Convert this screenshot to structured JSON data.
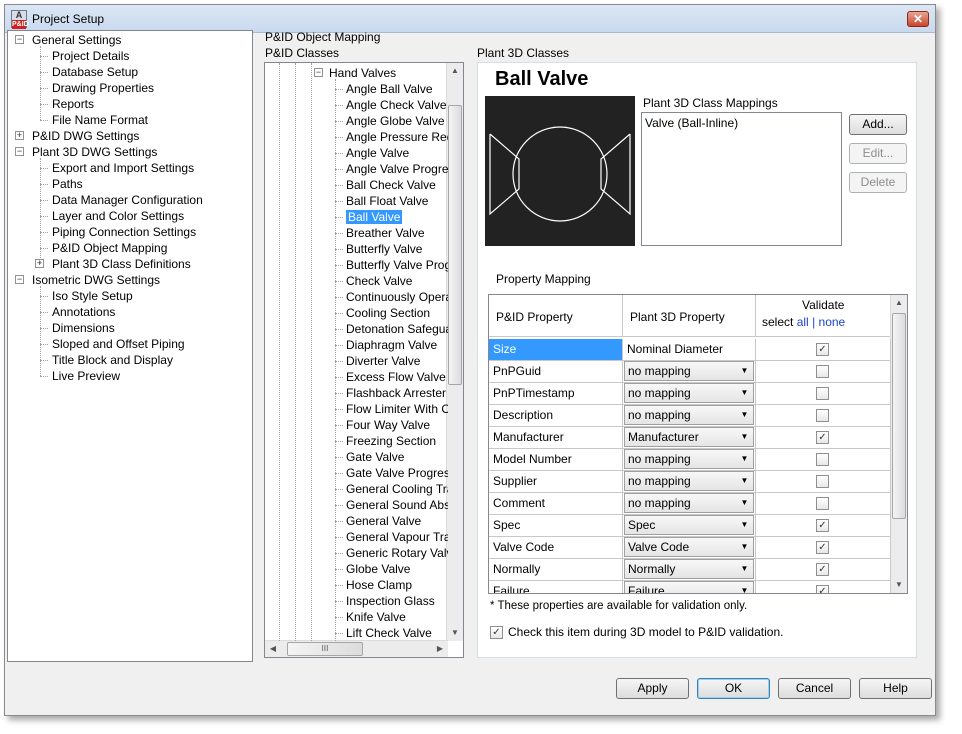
{
  "window": {
    "title": "Project Setup",
    "icon_text": "A",
    "icon_badge": "P&ID"
  },
  "left_tree": [
    {
      "label": "General Settings",
      "level": 0,
      "expander": "−"
    },
    {
      "label": "Project Details",
      "level": 1
    },
    {
      "label": "Database Setup",
      "level": 1
    },
    {
      "label": "Drawing Properties",
      "level": 1
    },
    {
      "label": "Reports",
      "level": 1
    },
    {
      "label": "File Name Format",
      "level": 1
    },
    {
      "label": "P&ID DWG Settings",
      "level": 0,
      "expander": "+"
    },
    {
      "label": "Plant 3D DWG Settings",
      "level": 0,
      "expander": "−"
    },
    {
      "label": "Export and Import Settings",
      "level": 1
    },
    {
      "label": "Paths",
      "level": 1
    },
    {
      "label": "Data Manager Configuration",
      "level": 1
    },
    {
      "label": "Layer and Color Settings",
      "level": 1
    },
    {
      "label": "Piping Connection Settings",
      "level": 1
    },
    {
      "label": "P&ID Object Mapping",
      "level": 1
    },
    {
      "label": "Plant 3D Class Definitions",
      "level": 1,
      "expander": "+"
    },
    {
      "label": "Isometric DWG Settings",
      "level": 0,
      "expander": "−"
    },
    {
      "label": "Iso Style Setup",
      "level": 1
    },
    {
      "label": "Annotations",
      "level": 1
    },
    {
      "label": "Dimensions",
      "level": 1
    },
    {
      "label": "Sloped and Offset Piping",
      "level": 1
    },
    {
      "label": "Title Block and Display",
      "level": 1
    },
    {
      "label": "Live Preview",
      "level": 1
    }
  ],
  "section": {
    "heading": "P&ID  Object Mapping",
    "pid_classes_label": "P&ID Classes",
    "plant3d_classes_label": "Plant 3D Classes"
  },
  "pid_classes": {
    "group": "Hand Valves",
    "items": [
      "Angle Ball Valve",
      "Angle Check Valve",
      "Angle Globe Valve",
      "Angle Pressure Redu",
      "Angle Valve",
      "Angle Valve Progress",
      "Ball Check Valve",
      "Ball Float Valve",
      "Ball Valve",
      "Breather Valve",
      "Butterfly Valve",
      "Butterfly Valve Progre",
      "Check Valve",
      "Continuously Operate",
      "Cooling Section",
      "Detonation Safeguar",
      "Diaphragm Valve",
      "Diverter Valve",
      "Excess Flow Valve",
      "Flashback Arrester",
      "Flow Limiter With Orif",
      "Four Way Valve",
      "Freezing Section",
      "Gate Valve",
      "Gate Valve Progressi",
      "General Cooling Trap",
      "General Sound Abso",
      "General Valve",
      "General Vapour Trap",
      "Generic Rotary Valve",
      "Globe Valve",
      "Hose Clamp",
      "Inspection Glass",
      "Knife Valve",
      "Lift Check Valve"
    ],
    "selected": "Ball Valve",
    "hscroll_grip": "III"
  },
  "plant3d": {
    "class_title": "Ball Valve",
    "mappings_label": "Plant 3D Class Mappings",
    "mappings": [
      "Valve (Ball-Inline)"
    ],
    "buttons": {
      "add": "Add...",
      "edit": "Edit...",
      "delete": "Delete"
    },
    "property_mapping_label": "Property Mapping"
  },
  "grid": {
    "headers": {
      "pid_property": "P&ID Property",
      "plant3d_property": "Plant 3D Property",
      "validate": "Validate",
      "select_prefix": "select",
      "select_all": "all",
      "separator": "|",
      "select_none": "none"
    },
    "rows": [
      {
        "pid": "Size",
        "plant": "Nominal Diameter",
        "combo": false,
        "checked": true,
        "selected": true
      },
      {
        "pid": "PnPGuid",
        "plant": "no mapping",
        "combo": true,
        "checked": false
      },
      {
        "pid": "PnPTimestamp",
        "plant": "no mapping",
        "combo": true,
        "checked": false
      },
      {
        "pid": "Description",
        "plant": "no mapping",
        "combo": true,
        "checked": false
      },
      {
        "pid": "Manufacturer",
        "plant": "Manufacturer",
        "combo": true,
        "checked": true
      },
      {
        "pid": "Model Number",
        "plant": "no mapping",
        "combo": true,
        "checked": false
      },
      {
        "pid": "Supplier",
        "plant": "no mapping",
        "combo": true,
        "checked": false
      },
      {
        "pid": "Comment",
        "plant": "no mapping",
        "combo": true,
        "checked": false
      },
      {
        "pid": "Spec",
        "plant": "Spec",
        "combo": true,
        "checked": true
      },
      {
        "pid": "Valve Code",
        "plant": "Valve Code",
        "combo": true,
        "checked": true
      },
      {
        "pid": "Normally",
        "plant": "Normally",
        "combo": true,
        "checked": true
      },
      {
        "pid": "Failure",
        "plant": "Failure",
        "combo": true,
        "checked": true
      }
    ]
  },
  "footnote": "* These properties are available for validation only.",
  "validation_checkbox": {
    "label": "Check this item during 3D model to P&ID validation.",
    "checked": true
  },
  "dialog_buttons": {
    "apply": "Apply",
    "ok": "OK",
    "cancel": "Cancel",
    "help": "Help"
  },
  "colors": {
    "selection": "#3399ff",
    "link": "#1a44c8",
    "preview_bg": "#222222"
  }
}
